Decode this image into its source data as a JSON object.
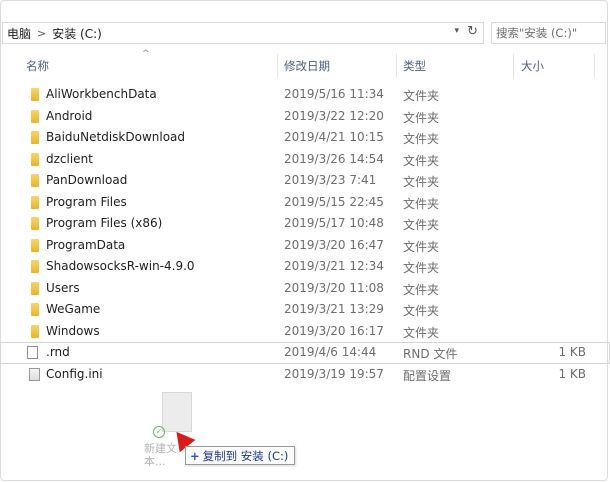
{
  "address": {
    "root": "电脑",
    "separator": ">",
    "current": "安装 (C:)"
  },
  "search": {
    "text": "搜索\"安装 (C:)\""
  },
  "columns": {
    "name": "名称",
    "date": "修改日期",
    "type": "类型",
    "size": "大小"
  },
  "files": [
    {
      "name": "AliWorkbenchData",
      "date": "2019/5/16 11:34",
      "type": "文件夹",
      "size": "",
      "icon": "folder-icon"
    },
    {
      "name": "Android",
      "date": "2019/3/22 12:20",
      "type": "文件夹",
      "size": "",
      "icon": "folder-icon"
    },
    {
      "name": "BaiduNetdiskDownload",
      "date": "2019/4/21 10:15",
      "type": "文件夹",
      "size": "",
      "icon": "folder-icon"
    },
    {
      "name": "dzclient",
      "date": "2019/3/26 14:54",
      "type": "文件夹",
      "size": "",
      "icon": "folder-icon"
    },
    {
      "name": "PanDownload",
      "date": "2019/3/23 7:41",
      "type": "文件夹",
      "size": "",
      "icon": "folder-icon"
    },
    {
      "name": "Program Files",
      "date": "2019/5/15 22:45",
      "type": "文件夹",
      "size": "",
      "icon": "folder-icon"
    },
    {
      "name": "Program Files (x86)",
      "date": "2019/5/17 10:48",
      "type": "文件夹",
      "size": "",
      "icon": "folder-icon"
    },
    {
      "name": "ProgramData",
      "date": "2019/3/20 16:47",
      "type": "文件夹",
      "size": "",
      "icon": "folder-icon"
    },
    {
      "name": "ShadowsocksR-win-4.9.0",
      "date": "2019/3/21 12:34",
      "type": "文件夹",
      "size": "",
      "icon": "folder-icon"
    },
    {
      "name": "Users",
      "date": "2019/3/20 11:08",
      "type": "文件夹",
      "size": "",
      "icon": "folder-icon"
    },
    {
      "name": "WeGame",
      "date": "2019/3/21 13:29",
      "type": "文件夹",
      "size": "",
      "icon": "folder-icon"
    },
    {
      "name": "Windows",
      "date": "2019/3/20 16:17",
      "type": "文件夹",
      "size": "",
      "icon": "folder-icon"
    },
    {
      "name": ".rnd",
      "date": "2019/4/6 14:44",
      "type": "RND 文件",
      "size": "1 KB",
      "icon": "file-icon"
    },
    {
      "name": "Config.ini",
      "date": "2019/3/19 19:57",
      "type": "配置设置",
      "size": "1 KB",
      "icon": "config-file-icon"
    }
  ],
  "drag": {
    "ghost_label": "新建文本...",
    "tooltip_text": "复制到 安装 (C:)",
    "tooltip_prefix": "+"
  },
  "colors": {
    "folder": "#e8b52c",
    "tooltip_text": "#1d3a84",
    "cursor": "#d81b1b"
  }
}
